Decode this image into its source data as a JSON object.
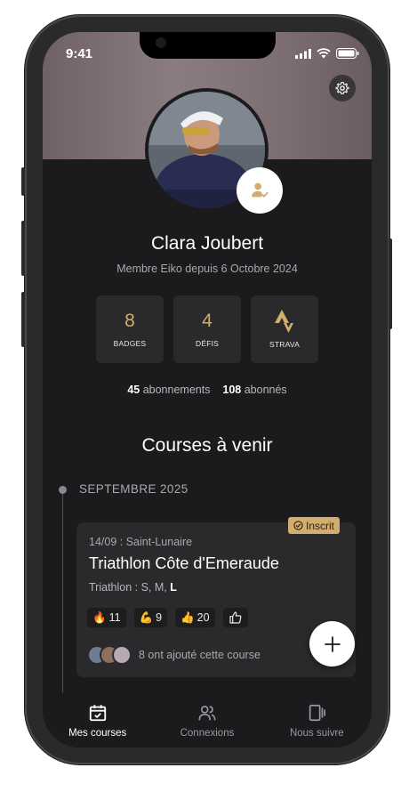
{
  "status_bar": {
    "time": "9:41"
  },
  "profile": {
    "name": "Clara Joubert",
    "member_since": "Membre Eiko depuis 6 Octobre 2024"
  },
  "stats": [
    {
      "value": "8",
      "label": "BADGES"
    },
    {
      "value": "4",
      "label": "DÉFIS"
    },
    {
      "value": "",
      "label": "STRAVA"
    }
  ],
  "follows": {
    "subscriptions_count": "45",
    "subscriptions_label": "abonnements",
    "followers_count": "108",
    "followers_label": "abonnés"
  },
  "upcoming": {
    "title": "Courses à venir",
    "month": "SEPTEMBRE 2025",
    "card": {
      "badge": "Inscrit",
      "date_place": "14/09 : Saint-Lunaire",
      "title": "Triathlon Côte d'Emeraude",
      "distances_prefix": "Triathlon : S, M, ",
      "distances_bold": "L",
      "reactions": [
        {
          "icon": "🔥",
          "count": "11"
        },
        {
          "icon": "💪",
          "count": "9"
        },
        {
          "icon": "👍",
          "count": "20"
        }
      ],
      "added_text": "8 ont ajouté cette course"
    }
  },
  "tabs": [
    {
      "label": "Mes courses",
      "icon": "calendar-check-icon",
      "active": true
    },
    {
      "label": "Connexions",
      "icon": "users-icon",
      "active": false
    },
    {
      "label": "Nous suivre",
      "icon": "follow-icon",
      "active": false
    }
  ],
  "colors": {
    "accent": "#d1ad6e",
    "background": "#1b1b1d",
    "card": "#2a2a2c"
  }
}
